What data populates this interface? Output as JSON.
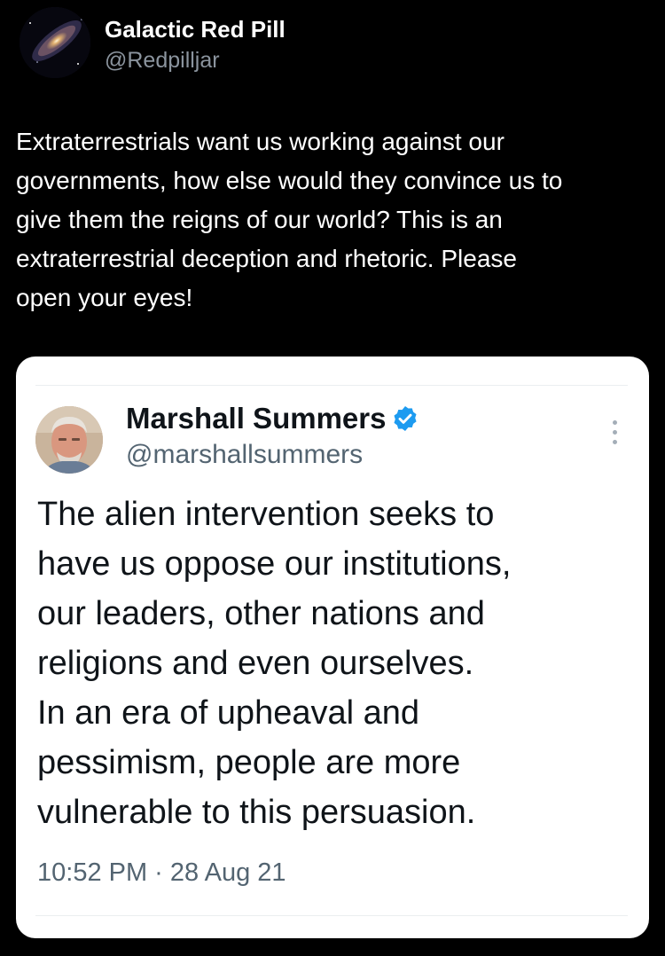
{
  "post": {
    "author": {
      "name": "Galactic Red Pill",
      "handle": "@Redpilljar",
      "avatar_icon": "galaxy-avatar"
    },
    "text_lines": [
      "Extraterrestrials want us working against our",
      "governments, how else would they convince us to",
      "give them the reigns of our world? This is an",
      "extraterrestrial deception and rhetoric. Please",
      "open your eyes!"
    ]
  },
  "quoted_tweet": {
    "author": {
      "name": "Marshall Summers",
      "handle": "@marshallsummers",
      "verified": true,
      "avatar_icon": "profile-photo"
    },
    "text_lines": [
      "The alien intervention seeks to",
      "have us oppose our institutions,",
      "our leaders, other nations and",
      "religions and even ourselves.",
      "In an era of upheaval and",
      "pessimism, people are more",
      "vulnerable to this persuasion."
    ],
    "timestamp": "10:52 PM · 28 Aug 21",
    "more_icon": "more-vertical-icon"
  },
  "colors": {
    "background": "#000000",
    "card_background": "#ffffff",
    "verified_blue": "#1d9bf0",
    "secondary_text_dark": "#8b949e",
    "secondary_text_light": "#536471"
  }
}
